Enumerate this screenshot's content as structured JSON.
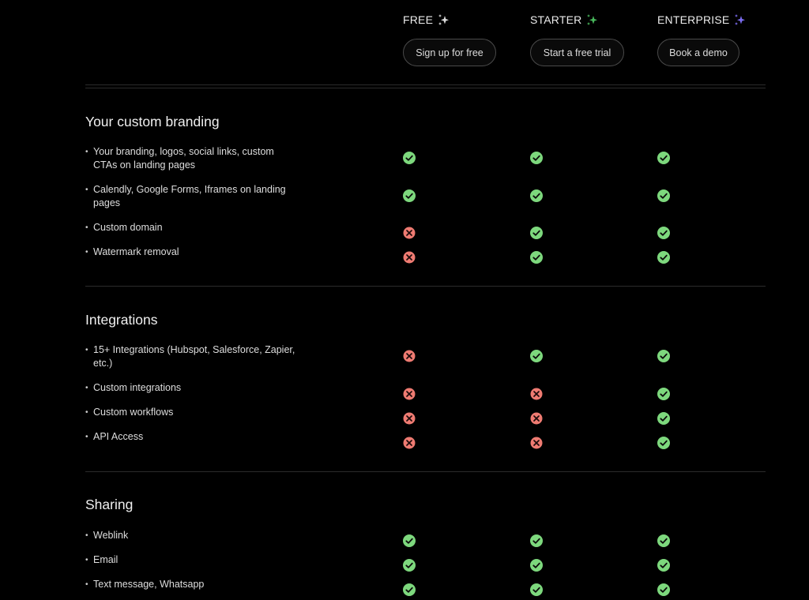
{
  "colors": {
    "check": "#7dd87d",
    "cross": "#ef7b72",
    "free_spark": "#d9d9d9",
    "starter_spark": "#48b85c",
    "enterprise_spark": "#7b6cf0"
  },
  "plans": [
    {
      "name": "FREE",
      "cta": "Sign up for free",
      "spark": "free_spark"
    },
    {
      "name": "STARTER",
      "cta": "Start a free trial",
      "spark": "starter_spark"
    },
    {
      "name": "ENTERPRISE",
      "cta": "Book a demo",
      "spark": "enterprise_spark"
    }
  ],
  "sections": [
    {
      "title": "Your custom branding",
      "features": [
        {
          "label": "Your branding, logos, social links, custom CTAs on landing pages",
          "values": [
            "check",
            "check",
            "check"
          ]
        },
        {
          "label": "Calendly, Google Forms, Iframes on landing pages",
          "values": [
            "check",
            "check",
            "check"
          ]
        },
        {
          "label": "Custom domain",
          "values": [
            "cross",
            "check",
            "check"
          ]
        },
        {
          "label": "Watermark removal",
          "values": [
            "cross",
            "check",
            "check"
          ]
        }
      ]
    },
    {
      "title": "Integrations",
      "features": [
        {
          "label": "15+ Integrations (Hubspot, Salesforce, Zapier, etc.)",
          "values": [
            "cross",
            "check",
            "check"
          ]
        },
        {
          "label": "Custom integrations",
          "values": [
            "cross",
            "cross",
            "check"
          ]
        },
        {
          "label": "Custom workflows",
          "values": [
            "cross",
            "cross",
            "check"
          ]
        },
        {
          "label": "API Access",
          "values": [
            "cross",
            "cross",
            "check"
          ]
        }
      ]
    },
    {
      "title": "Sharing",
      "features": [
        {
          "label": "Weblink",
          "values": [
            "check",
            "check",
            "check"
          ]
        },
        {
          "label": "Email",
          "values": [
            "check",
            "check",
            "check"
          ]
        },
        {
          "label": "Text message, Whatsapp",
          "values": [
            "check",
            "check",
            "check"
          ]
        }
      ]
    }
  ]
}
